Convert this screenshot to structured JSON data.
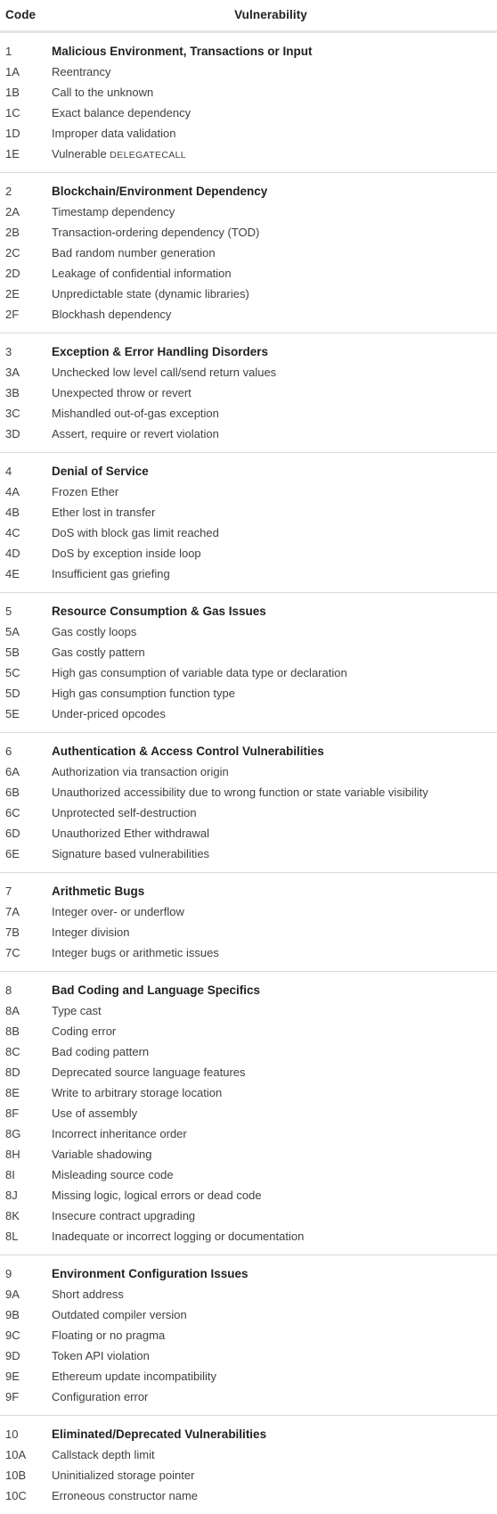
{
  "table": {
    "columns": {
      "code": "Code",
      "vulnerability": "Vulnerability"
    },
    "groups": [
      {
        "code": "1",
        "title": "Malicious Environment, Transactions or Input",
        "rows": [
          {
            "code": "1A",
            "label": "Reentrancy"
          },
          {
            "code": "1B",
            "label": "Call to the unknown"
          },
          {
            "code": "1C",
            "label": "Exact balance dependency"
          },
          {
            "code": "1D",
            "label": "Improper data validation"
          },
          {
            "code": "1E",
            "label": "Vulnerable ",
            "mono": "DELEGATECALL"
          }
        ]
      },
      {
        "code": "2",
        "title": "Blockchain/Environment Dependency",
        "rows": [
          {
            "code": "2A",
            "label": "Timestamp dependency"
          },
          {
            "code": "2B",
            "label": "Transaction-ordering dependency (TOD)"
          },
          {
            "code": "2C",
            "label": "Bad random number generation"
          },
          {
            "code": "2D",
            "label": "Leakage of confidential information"
          },
          {
            "code": "2E",
            "label": "Unpredictable state (dynamic libraries)"
          },
          {
            "code": "2F",
            "label": "Blockhash dependency"
          }
        ]
      },
      {
        "code": "3",
        "title": "Exception & Error Handling Disorders",
        "rows": [
          {
            "code": "3A",
            "label": "Unchecked low level call/send return values"
          },
          {
            "code": "3B",
            "label": "Unexpected throw or revert"
          },
          {
            "code": "3C",
            "label": "Mishandled out-of-gas exception"
          },
          {
            "code": "3D",
            "label": "Assert, require or revert violation"
          }
        ]
      },
      {
        "code": "4",
        "title": "Denial of Service",
        "rows": [
          {
            "code": "4A",
            "label": "Frozen Ether"
          },
          {
            "code": "4B",
            "label": "Ether lost in transfer"
          },
          {
            "code": "4C",
            "label": "DoS with block gas limit reached"
          },
          {
            "code": "4D",
            "label": "DoS by exception inside loop"
          },
          {
            "code": "4E",
            "label": "Insufficient gas griefing"
          }
        ]
      },
      {
        "code": "5",
        "title": "Resource Consumption & Gas Issues",
        "rows": [
          {
            "code": "5A",
            "label": "Gas costly loops"
          },
          {
            "code": "5B",
            "label": "Gas costly pattern"
          },
          {
            "code": "5C",
            "label": "High gas consumption of variable data type or declaration"
          },
          {
            "code": "5D",
            "label": "High gas consumption function type"
          },
          {
            "code": "5E",
            "label": "Under-priced opcodes"
          }
        ]
      },
      {
        "code": "6",
        "title": "Authentication & Access Control Vulnerabilities",
        "rows": [
          {
            "code": "6A",
            "label": "Authorization via transaction origin"
          },
          {
            "code": "6B",
            "label": "Unauthorized accessibility due to wrong function or state variable visibility"
          },
          {
            "code": "6C",
            "label": "Unprotected self-destruction"
          },
          {
            "code": "6D",
            "label": "Unauthorized Ether withdrawal"
          },
          {
            "code": "6E",
            "label": "Signature based vulnerabilities"
          }
        ]
      },
      {
        "code": "7",
        "title": "Arithmetic Bugs",
        "rows": [
          {
            "code": "7A",
            "label": "Integer over- or underflow"
          },
          {
            "code": "7B",
            "label": "Integer division"
          },
          {
            "code": "7C",
            "label": "Integer bugs or arithmetic issues"
          }
        ]
      },
      {
        "code": "8",
        "title": "Bad Coding and Language Specifics",
        "rows": [
          {
            "code": "8A",
            "label": "Type cast"
          },
          {
            "code": "8B",
            "label": "Coding error"
          },
          {
            "code": "8C",
            "label": "Bad coding pattern"
          },
          {
            "code": "8D",
            "label": "Deprecated source language features"
          },
          {
            "code": "8E",
            "label": "Write to arbitrary storage location"
          },
          {
            "code": "8F",
            "label": "Use of assembly"
          },
          {
            "code": "8G",
            "label": "Incorrect inheritance order"
          },
          {
            "code": "8H",
            "label": "Variable shadowing"
          },
          {
            "code": "8I",
            "label": "Misleading source code"
          },
          {
            "code": "8J",
            "label": "Missing logic, logical errors or dead code"
          },
          {
            "code": "8K",
            "label": "Insecure contract upgrading"
          },
          {
            "code": "8L",
            "label": "Inadequate or incorrect logging or documentation"
          }
        ]
      },
      {
        "code": "9",
        "title": "Environment Configuration Issues",
        "rows": [
          {
            "code": "9A",
            "label": "Short address"
          },
          {
            "code": "9B",
            "label": "Outdated compiler version"
          },
          {
            "code": "9C",
            "label": "Floating or no pragma"
          },
          {
            "code": "9D",
            "label": "Token API violation"
          },
          {
            "code": "9E",
            "label": "Ethereum update incompatibility"
          },
          {
            "code": "9F",
            "label": "Configuration error"
          }
        ]
      },
      {
        "code": "10",
        "title": "Eliminated/Deprecated Vulnerabilities",
        "rows": [
          {
            "code": "10A",
            "label": "Callstack depth limit"
          },
          {
            "code": "10B",
            "label": "Uninitialized storage pointer"
          },
          {
            "code": "10C",
            "label": "Erroneous constructor name"
          }
        ]
      }
    ]
  },
  "colors": {
    "text": "#3f3f3f",
    "heading": "#231f20",
    "rule": "#e4e4e4",
    "rule_thin": "#d9d9d9",
    "background": "#ffffff"
  }
}
